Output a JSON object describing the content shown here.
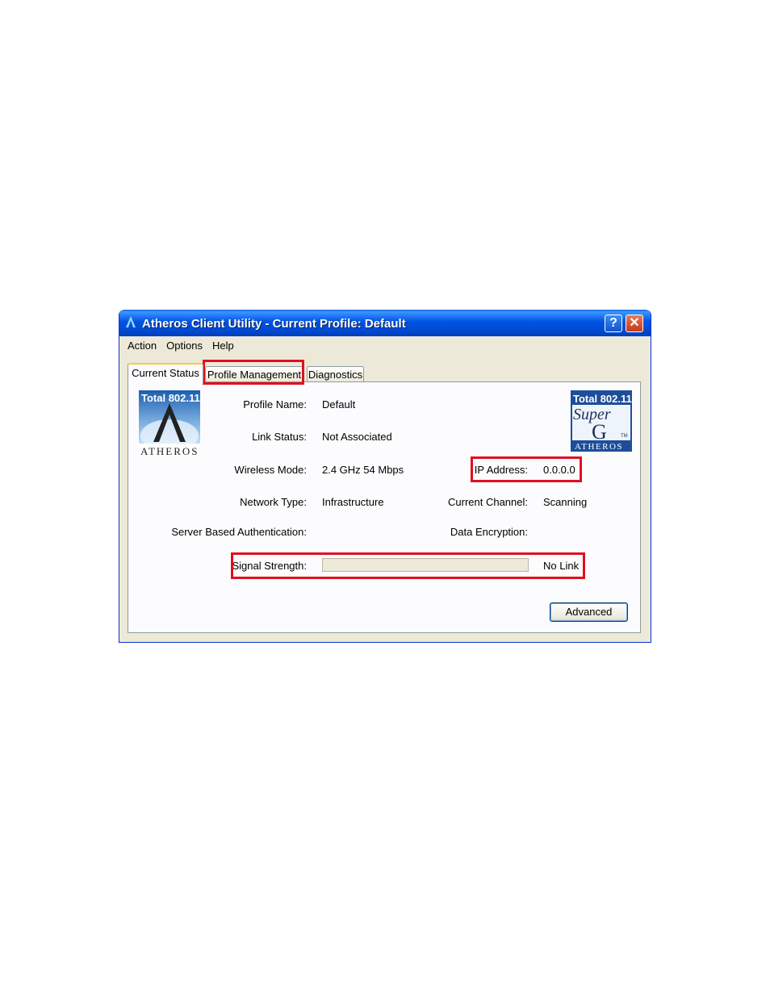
{
  "window": {
    "title": "Atheros Client Utility - Current Profile: Default",
    "help_label": "?",
    "close_label": "✕"
  },
  "menu": [
    "Action",
    "Options",
    "Help"
  ],
  "tabs": [
    "Current Status",
    "Profile Management",
    "Diagnostics"
  ],
  "logos": {
    "left": {
      "top": "Total 802.11",
      "brand": "ATHEROS"
    },
    "right": {
      "top": "Total 802.11",
      "script": "Super",
      "letter": "G",
      "tm": "TM",
      "brand": "ATHEROS"
    }
  },
  "status": {
    "profile_name_label": "Profile Name:",
    "profile_name": "Default",
    "link_status_label": "Link Status:",
    "link_status": "Not Associated",
    "wireless_mode_label": "Wireless Mode:",
    "wireless_mode": "2.4 GHz 54 Mbps",
    "ip_label": "IP Address:",
    "ip": "0.0.0.0",
    "network_type_label": "Network Type:",
    "network_type": "Infrastructure",
    "channel_label": "Current Channel:",
    "channel": "Scanning",
    "auth_label": "Server Based Authentication:",
    "encryption_label": "Data Encryption:",
    "signal_label": "Signal Strength:",
    "signal_text": "No Link",
    "signal_level": 0
  },
  "buttons": {
    "advanced": "Advanced"
  },
  "colors": {
    "highlight": "#e01020",
    "titlebar": "#0054e3",
    "tab_accent": "#ffc83c"
  }
}
